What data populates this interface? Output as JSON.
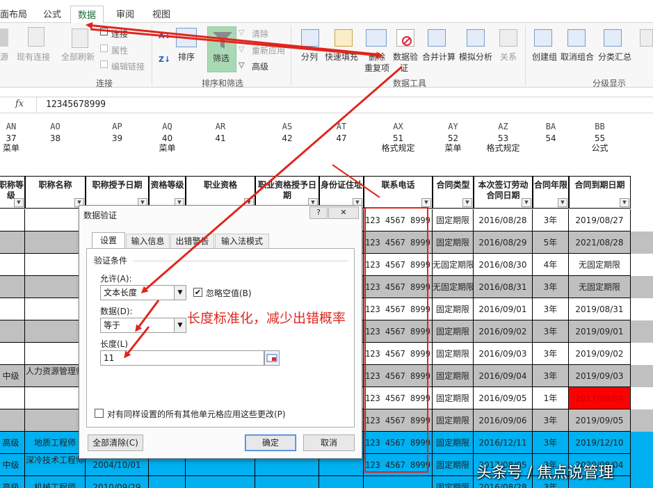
{
  "tabs": [
    {
      "label": "面布局"
    },
    {
      "label": "公式"
    },
    {
      "label": "数据"
    },
    {
      "label": "审阅"
    },
    {
      "label": "视图"
    }
  ],
  "ribbon": {
    "connect": {
      "source": "源",
      "existing": "现有连接",
      "refresh_all": "全部刷新",
      "connections": "连接",
      "properties": "属性",
      "edit_links": "编辑链接",
      "group": "连接"
    },
    "sort_filter": {
      "sort": "排序",
      "filter": "筛选",
      "clear": "清除",
      "reapply": "重新应用",
      "advanced": "高级",
      "group": "排序和筛选"
    },
    "tools": {
      "text_to_columns": "分列",
      "flash_fill": "快速填充",
      "remove_dup_line1": "删除",
      "remove_dup_line2": "重复项",
      "validation_line1": "数据验",
      "validation_line2": "证",
      "consolidate": "合并计算",
      "what_if": "模拟分析",
      "relationships": "关系",
      "group": "数据工具"
    },
    "outline": {
      "group_btn": "创建组",
      "ungroup": "取消组合",
      "subtotal": "分类汇总",
      "group": "分级显示"
    }
  },
  "formula_bar": {
    "fx": "fx",
    "value": "12345678999"
  },
  "columns": [
    {
      "letter": "AN",
      "num": "37",
      "tag": "菜单",
      "header": "职称等级"
    },
    {
      "letter": "AO",
      "num": "38",
      "tag": "",
      "header": "职称名称"
    },
    {
      "letter": "AP",
      "num": "39",
      "tag": "",
      "header": "职称授予日期"
    },
    {
      "letter": "AQ",
      "num": "40",
      "tag": "菜单",
      "header": "资格等级"
    },
    {
      "letter": "AR",
      "num": "41",
      "tag": "",
      "header": "职业资格"
    },
    {
      "letter": "AS",
      "num": "42",
      "tag": "",
      "header": "职业资格授予日期"
    },
    {
      "letter": "AT",
      "num": "47",
      "tag": "",
      "header": "身份证住址"
    },
    {
      "letter": "AX",
      "num": "51",
      "tag": "格式规定",
      "header": "联系电话"
    },
    {
      "letter": "AY",
      "num": "52",
      "tag": "菜单",
      "header": "合同类型"
    },
    {
      "letter": "AZ",
      "num": "53",
      "tag": "格式规定",
      "header": "本次签订劳动合同日期"
    },
    {
      "letter": "BA",
      "num": "54",
      "tag": "",
      "header": "合同年限"
    },
    {
      "letter": "BB",
      "num": "55",
      "tag": "公式",
      "header": "合同到期日期"
    }
  ],
  "rows": [
    {
      "an": "",
      "ao": "",
      "ap": "",
      "phone": "123 4567 8999",
      "type": "固定期限",
      "sign": "2016/08/28",
      "years": "3年",
      "expire": "2019/08/27",
      "bg": "#ffffff"
    },
    {
      "an": "",
      "ao": "",
      "ap": "",
      "phone": "123 4567 8999",
      "type": "固定期限",
      "sign": "2016/08/29",
      "years": "5年",
      "expire": "2021/08/28",
      "bg": "#c0c0c0"
    },
    {
      "an": "",
      "ao": "",
      "ap": "",
      "phone": "123 4567 8999",
      "type": "无固定期限",
      "sign": "2016/08/30",
      "years": "4年",
      "expire": "无固定期限",
      "bg": "#ffffff"
    },
    {
      "an": "",
      "ao": "",
      "ap": "",
      "phone": "123 4567 8999",
      "type": "无固定期限",
      "sign": "2016/08/31",
      "years": "3年",
      "expire": "无固定期限",
      "bg": "#c0c0c0"
    },
    {
      "an": "",
      "ao": "",
      "ap": "",
      "phone": "123 4567 8999",
      "type": "固定期限",
      "sign": "2016/09/01",
      "years": "3年",
      "expire": "2019/08/31",
      "bg": "#ffffff"
    },
    {
      "an": "",
      "ao": "",
      "ap": "",
      "phone": "123 4567 8999",
      "type": "固定期限",
      "sign": "2016/09/02",
      "years": "3年",
      "expire": "2019/09/01",
      "bg": "#c0c0c0"
    },
    {
      "an": "",
      "ao": "",
      "ap": "",
      "phone": "123 4567 8999",
      "type": "固定期限",
      "sign": "2016/09/03",
      "years": "3年",
      "expire": "2019/09/02",
      "bg": "#ffffff"
    },
    {
      "an": "中级",
      "ao": "人力资源管理师",
      "ap": "",
      "phone": "123 4567 8999",
      "type": "固定期限",
      "sign": "2016/09/04",
      "years": "3年",
      "expire": "2019/09/03",
      "bg": "#c0c0c0"
    },
    {
      "an": "",
      "ao": "",
      "ap": "",
      "phone": "123 4567 8999",
      "type": "固定期限",
      "sign": "2016/09/05",
      "years": "1年",
      "expire": "2017/09/04",
      "bg": "#ffffff",
      "expire_bg": "#ff0000"
    },
    {
      "an": "",
      "ao": "",
      "ap": "",
      "phone": "123 4567 8999",
      "type": "固定期限",
      "sign": "2016/09/06",
      "years": "3年",
      "expire": "2019/09/05",
      "bg": "#c0c0c0"
    },
    {
      "an": "高级",
      "ao": "地质工程师",
      "ap": "",
      "phone": "123 4567 8999",
      "type": "固定期限",
      "sign": "2016/12/11",
      "years": "3年",
      "expire": "2019/12/10",
      "bg": "#00b0f0"
    },
    {
      "an": "中级",
      "ao": "深冷技术工程师",
      "ap": "2004/10/01",
      "phone": "123 4567 8999",
      "type": "固定期限",
      "sign": "2017/08/05",
      "years": "3年",
      "expire": "2020/08/04",
      "bg": "#00b0f0"
    },
    {
      "an": "高级",
      "ao": "机械工程师",
      "ap": "2010/09/29",
      "phone": "",
      "type": "固定期限",
      "sign": "2016/08/28",
      "years": "3年",
      "expire": "",
      "bg": "#00b0f0"
    }
  ],
  "dialog": {
    "title": "数据验证",
    "help": "?",
    "close": "✕",
    "tabs": [
      "设置",
      "输入信息",
      "出错警告",
      "输入法模式"
    ],
    "criteria_label": "验证条件",
    "allow_label": "允许(A):",
    "allow_value": "文本长度",
    "ignore_blank": "忽略空值(B)",
    "data_label": "数据(D):",
    "data_value": "等于",
    "length_label": "长度(L)",
    "length_value": "11",
    "apply_all": "对有同样设置的所有其他单元格应用这些更改(P)",
    "clear_all": "全部清除(C)",
    "ok": "确定",
    "cancel": "取消"
  },
  "annotation": "长度标准化，减少出错概率",
  "watermark": "头条号 / 焦点说管理",
  "colors": {
    "accent_red": "#e0251c",
    "excel_green": "#1e6b3a",
    "row_gray": "#c0c0c0",
    "row_blue": "#00b0f0",
    "alert_red": "#ff0000"
  }
}
